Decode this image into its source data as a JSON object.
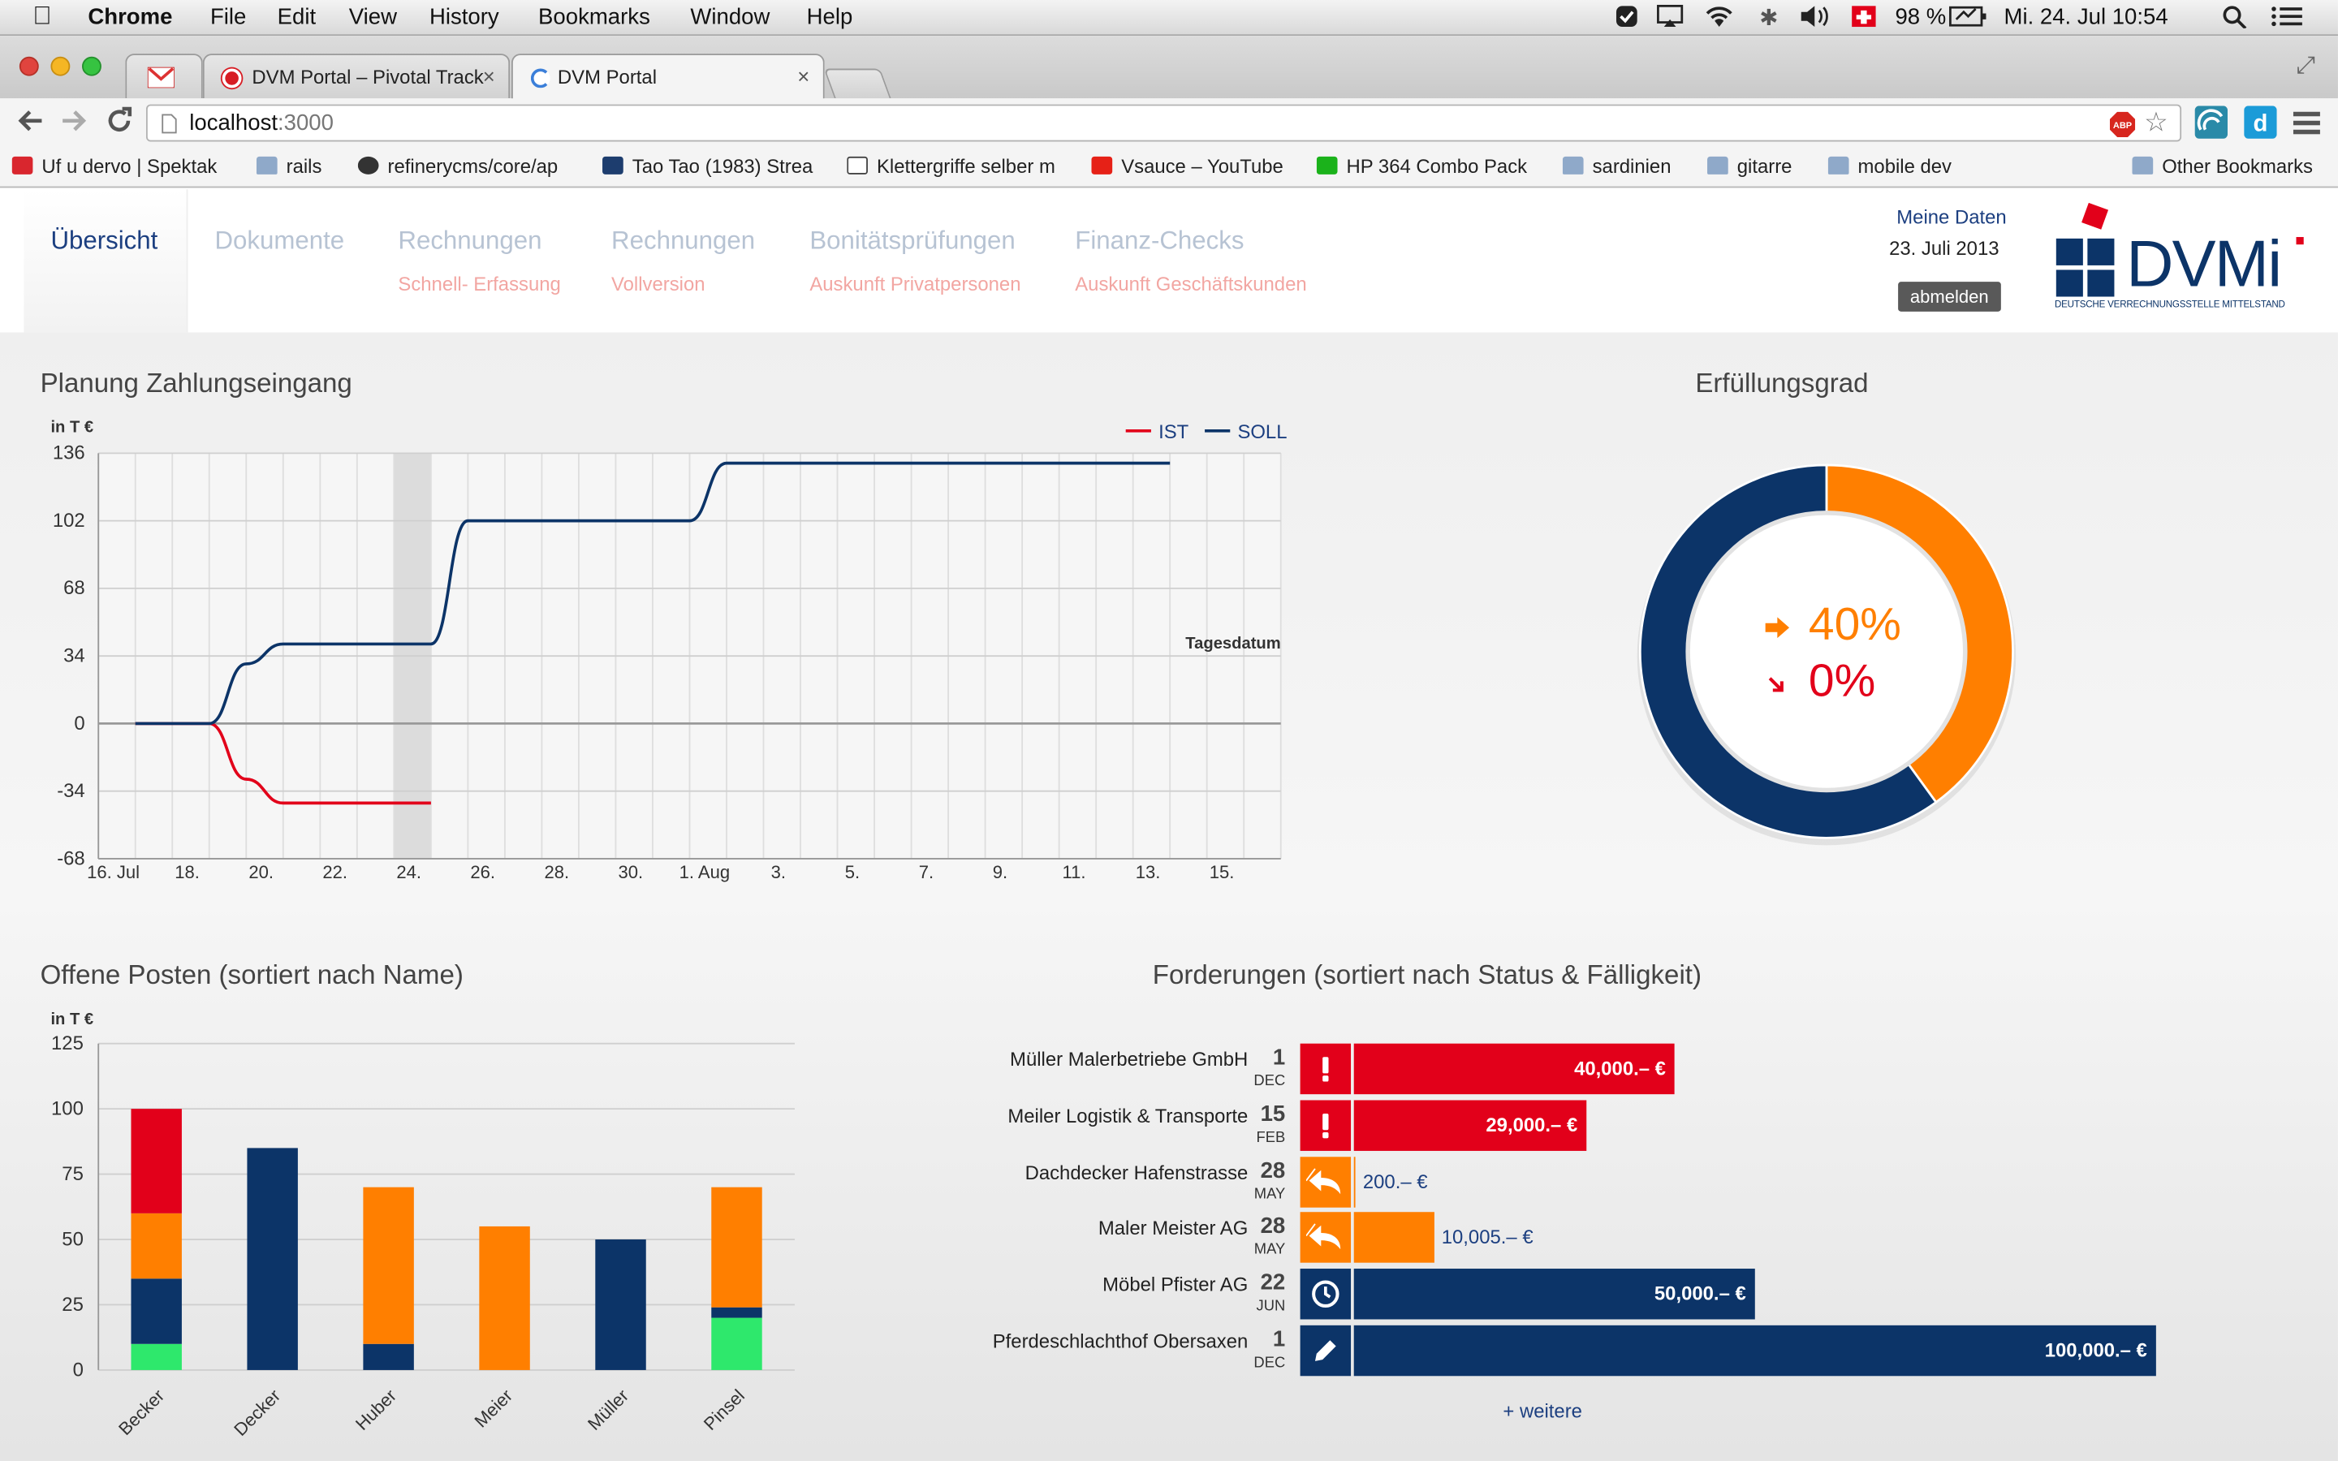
{
  "menubar": {
    "app": "Chrome",
    "menus": [
      "File",
      "Edit",
      "View",
      "History",
      "Bookmarks",
      "Window",
      "Help"
    ],
    "battery": "98 %",
    "clock": "Mi. 24. Jul  10:54"
  },
  "tabs": [
    {
      "label": ""
    },
    {
      "label": "DVM Portal – Pivotal Track"
    },
    {
      "label": "DVM Portal"
    }
  ],
  "omnibox": {
    "url_host": "localhost",
    "url_port": ":3000"
  },
  "bookmarks": [
    {
      "label": "Uf u dervo | Spektak"
    },
    {
      "label": "rails"
    },
    {
      "label": "refinerycms/core/ap"
    },
    {
      "label": "Tao Tao (1983) Strea"
    },
    {
      "label": "Klettergriffe selber m"
    },
    {
      "label": "Vsauce – YouTube"
    },
    {
      "label": "HP 364 Combo Pack"
    },
    {
      "label": "sardinien"
    },
    {
      "label": "gitarre"
    },
    {
      "label": "mobile dev"
    },
    {
      "label": "Other Bookmarks"
    }
  ],
  "nav": {
    "items": [
      {
        "label": "Übersicht",
        "sub": ""
      },
      {
        "label": "Dokumente",
        "sub": ""
      },
      {
        "label": "Rechnungen",
        "sub": "Schnell- Erfassung"
      },
      {
        "label": "Rechnungen",
        "sub": "Vollversion"
      },
      {
        "label": "Bonitätsprüfungen",
        "sub": "Auskunft Privatpersonen"
      },
      {
        "label": "Finanz-Checks",
        "sub": "Auskunft Geschäftskunden"
      }
    ],
    "user": {
      "meine_daten": "Meine Daten",
      "date": "23. Juli 2013",
      "logout": "abmelden"
    },
    "logo": {
      "text": "DVMi",
      "tagline": "DEUTSCHE VERRECHNUNGSSTELLE MITTELSTAND"
    }
  },
  "sections": {
    "planung": "Planung Zahlungseingang",
    "erfuellung": "Erfüllungsgrad",
    "offene": "Offene Posten (sortiert nach Name)",
    "forderungen": "Forderungen (sortiert nach Status & Fälligkeit)"
  },
  "gauge": {
    "value1": "40%",
    "value2": "0%"
  },
  "colors": {
    "ist": "#e2001a",
    "soll": "#0c3468",
    "orange": "#ff7f00",
    "green": "#2ee86c"
  },
  "chart_data": [
    {
      "type": "line",
      "unit_label": "in T €",
      "x_tick_labels": [
        "16. Jul",
        "18.",
        "20.",
        "22.",
        "24.",
        "26.",
        "28.",
        "30.",
        "1. Aug",
        "3.",
        "5.",
        "7.",
        "9.",
        "11.",
        "13.",
        "15."
      ],
      "ylim": [
        -68,
        136
      ],
      "y_ticks": [
        136,
        102,
        68,
        34,
        0,
        -34,
        -68
      ],
      "annotation": "Tagesdatum",
      "highlight_band": [
        "24.",
        "25."
      ],
      "legend_position": "top-right",
      "series": [
        {
          "name": "IST",
          "x": [
            "2013-07-17",
            "2013-07-18",
            "2013-07-19",
            "2013-07-20",
            "2013-07-21",
            "2013-07-24",
            "2013-07-25"
          ],
          "values": [
            0,
            0,
            0,
            -28,
            -40,
            -40,
            -40
          ]
        },
        {
          "name": "SOLL",
          "x": [
            "2013-07-17",
            "2013-07-18",
            "2013-07-19",
            "2013-07-20",
            "2013-07-21",
            "2013-07-24",
            "2013-07-25",
            "2013-07-26",
            "2013-08-01",
            "2013-08-02",
            "2013-08-14"
          ],
          "values": [
            0,
            0,
            0,
            30,
            40,
            40,
            40,
            102,
            102,
            131,
            131
          ]
        }
      ]
    },
    {
      "type": "pie",
      "title": "",
      "slices": [
        {
          "value": 40,
          "color": "#ff7f00"
        },
        {
          "value": 60,
          "color": "#0c3468"
        }
      ]
    },
    {
      "type": "bar",
      "stacked": true,
      "unit_label": "in T €",
      "categories": [
        "Becker",
        "Decker",
        "Huber",
        "Meier",
        "Müller",
        "Pinsel"
      ],
      "ylim": [
        0,
        125
      ],
      "y_ticks": [
        125,
        100,
        75,
        50,
        25,
        0
      ],
      "series": [
        {
          "color": "#2ee86c",
          "values": [
            10,
            0,
            0,
            0,
            0,
            20
          ]
        },
        {
          "color": "#0c3468",
          "values": [
            25,
            85,
            10,
            0,
            50,
            4
          ]
        },
        {
          "color": "#ff7f00",
          "values": [
            25,
            0,
            60,
            55,
            0,
            46
          ]
        },
        {
          "color": "#e2001a",
          "values": [
            40,
            0,
            0,
            0,
            0,
            0
          ]
        }
      ]
    },
    {
      "type": "bar",
      "orientation": "horizontal",
      "rows": [
        {
          "name": "Müller Malerbetriebe GmbH",
          "day": "1",
          "month": "DEC",
          "amount": "40,000.– €",
          "value": 40000,
          "status": "alert",
          "color": "#e2001a"
        },
        {
          "name": "Meiler Logistik & Transporte",
          "day": "15",
          "month": "FEB",
          "amount": "29,000.– €",
          "value": 29000,
          "status": "alert",
          "color": "#e2001a"
        },
        {
          "name": "Dachdecker Hafenstrasse",
          "day": "28",
          "month": "MAY",
          "amount": "200.– €",
          "value": 200,
          "status": "reply",
          "color": "#ff7f00"
        },
        {
          "name": "Maler Meister AG",
          "day": "28",
          "month": "MAY",
          "amount": "10,005.– €",
          "value": 10005,
          "status": "reply",
          "color": "#ff7f00"
        },
        {
          "name": "Möbel Pfister AG",
          "day": "22",
          "month": "JUN",
          "amount": "50,000.– €",
          "value": 50000,
          "status": "clock",
          "color": "#0c3468"
        },
        {
          "name": "Pferdeschlachthof Obersaxen",
          "day": "1",
          "month": "DEC",
          "amount": "100,000.– €",
          "value": 100000,
          "status": "edit",
          "color": "#0c3468"
        }
      ],
      "more": "+ weitere"
    }
  ]
}
